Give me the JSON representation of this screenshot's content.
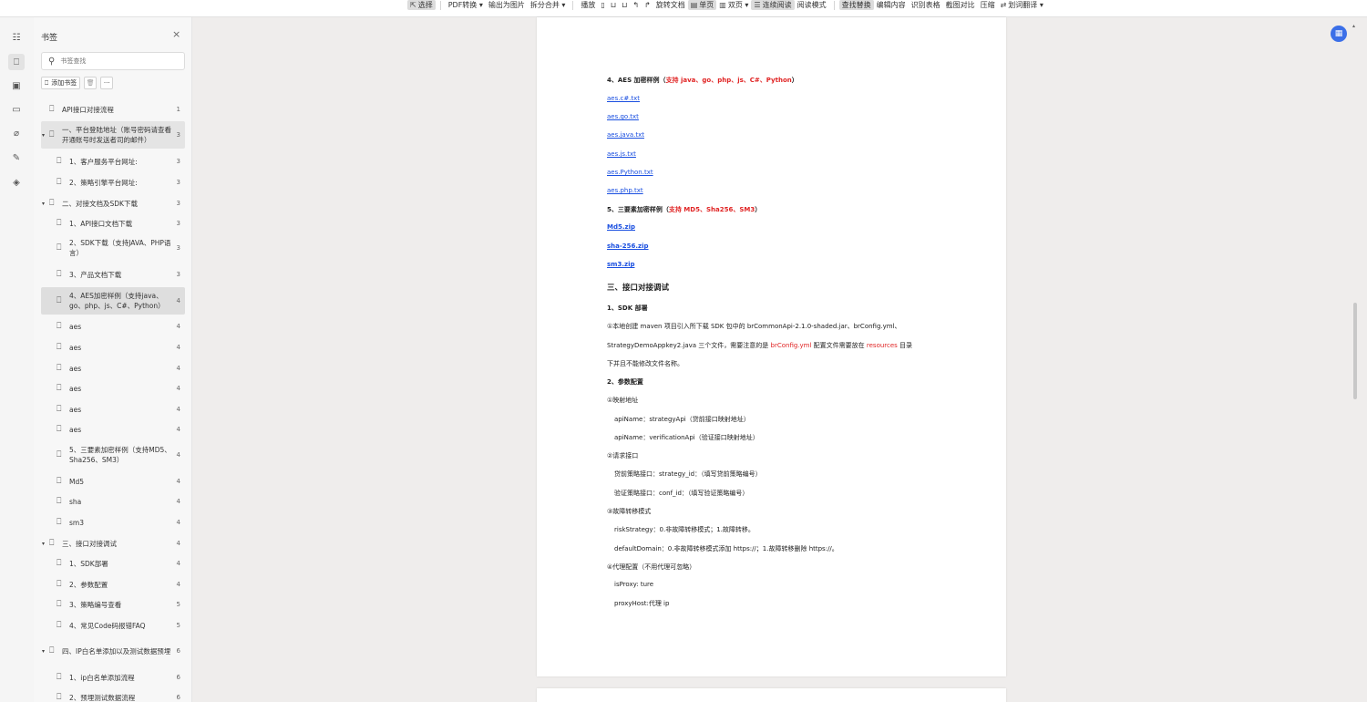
{
  "toolbar": {
    "items": [
      {
        "icon": "cursor-icon",
        "label": "选择",
        "active": true
      },
      {
        "label": "PDF转换 ▾"
      },
      {
        "label": "输出为图片"
      },
      {
        "label": "拆分合并 ▾"
      },
      {
        "label": "播放"
      },
      {
        "label": "旋转文档"
      },
      {
        "label": "单页",
        "active": true
      },
      {
        "label": "双页 ▾"
      },
      {
        "label": "连续阅读",
        "active": true
      },
      {
        "label": "阅读模式"
      },
      {
        "label": "查找替换",
        "active": true
      },
      {
        "label": "编辑内容"
      },
      {
        "label": "识别表格"
      },
      {
        "label": "截图对比"
      },
      {
        "label": "压缩"
      },
      {
        "label": "划词翻译 ▾"
      }
    ]
  },
  "rail": {
    "icons": [
      "outline-icon",
      "bookmark-icon",
      "thumbnail-icon",
      "comment-icon",
      "attachment-icon",
      "signature-icon",
      "layers-icon"
    ]
  },
  "panel": {
    "title": "书签",
    "search_placeholder": "书签查找",
    "add_bookmark": "添加书签",
    "bookmarks": [
      {
        "label": "API接口对接流程",
        "page": "1"
      },
      {
        "label": "一、平台登陆地址（账号密码请查看开通账号时发送者司的邮件）",
        "page": "3",
        "expanded": true
      },
      {
        "label": "1、客户服务平台网址:",
        "page": "3"
      },
      {
        "label": "2、策略引擎平台网址:",
        "page": "3"
      },
      {
        "label": "二、对接文档及SDK下载",
        "page": "3",
        "expanded": true
      },
      {
        "label": "1、API接口文档下载",
        "page": "3"
      },
      {
        "label": "2、SDK下载（支持JAVA、PHP语言）",
        "page": "3"
      },
      {
        "label": "3、产品文档下载",
        "page": "3"
      },
      {
        "label": "4、AES加密样例（支持java、go、php、js、C#、Python）",
        "page": "4",
        "selected": true
      },
      {
        "label": "aes",
        "page": "4"
      },
      {
        "label": "aes",
        "page": "4"
      },
      {
        "label": "aes",
        "page": "4"
      },
      {
        "label": "aes",
        "page": "4"
      },
      {
        "label": "aes",
        "page": "4"
      },
      {
        "label": "aes",
        "page": "4"
      },
      {
        "label": "5、三要素加密样例（支持MD5、Sha256、SM3）",
        "page": "4"
      },
      {
        "label": "Md5",
        "page": "4"
      },
      {
        "label": "sha",
        "page": "4"
      },
      {
        "label": "sm3",
        "page": "4"
      },
      {
        "label": "三、接口对接调试",
        "page": "4",
        "expanded": true
      },
      {
        "label": "1、SDK部署",
        "page": "4"
      },
      {
        "label": "2、参数配置",
        "page": "4"
      },
      {
        "label": "3、策略编号查看",
        "page": "5"
      },
      {
        "label": "4、常见Code码报错FAQ",
        "page": "5"
      },
      {
        "label": "四、IP白名单添加以及测试数据预埋",
        "page": "6",
        "expanded": true
      },
      {
        "label": "1、ip白名单添加流程",
        "page": "6"
      },
      {
        "label": "2、预埋测试数据流程",
        "page": "6"
      }
    ]
  },
  "document": {
    "aes_heading_prefix": "4、AES 加密样例（",
    "aes_heading_red": "支持 java、go、php、js、C#、Python",
    "aes_heading_suffix": "）",
    "aes_files": [
      "aes.c#.txt",
      "aes.go.txt",
      "aes.java.txt",
      "aes.js.txt",
      "aes.Python.txt",
      "aes.php.txt"
    ],
    "three_heading_prefix": "5、三要素加密样例（",
    "three_heading_red": "支持 MD5、Sha256、SM3",
    "three_heading_suffix": "）",
    "three_files": [
      "Md5.zip",
      "sha-256.zip",
      "sm3.zip"
    ],
    "section3_title": "三、接口对接调试",
    "sdk_title": "1、SDK 部署",
    "sdk_line1": "①本地创建 maven 项目引入所下载 SDK 包中的 brCommonApi-2.1.0-shaded.jar、brConfig.yml、",
    "sdk_line2_a": "StrategyDemoAppkey2.java 三个文件，需要注意的是 ",
    "sdk_line2_red1": "brConfig.yml",
    "sdk_line2_b": " 配置文件需要放在 ",
    "sdk_line2_red2": "resources",
    "sdk_line2_c": " 目录",
    "sdk_line3": "下并且不能修改文件名称。",
    "param_title": "2、参数配置",
    "map_title": "①映射地址",
    "map_line1": "apiName：strategyApi（贷前接口映射地址）",
    "map_line2": "apiName：verificationApi（验证接口映射地址）",
    "req_title": "②请求接口",
    "req_line1": "贷前策略接口：strategy_id：（填写贷前策略编号）",
    "req_line2": "验证策略接口：conf_id：（填写验证策略编号）",
    "fail_title": "③故障转移模式",
    "fail_line1": "riskStrategy：0.非故障转移模式；1.故障转移。",
    "fail_line2": "defaultDomain：0.非故障转移模式添加 https://；1.故障转移删除 https://。",
    "proxy_title": "④代理配置（不用代理可忽略）",
    "proxy_line1": "isProxy: ture",
    "proxy_line2": "proxyHost:代理 ip"
  }
}
